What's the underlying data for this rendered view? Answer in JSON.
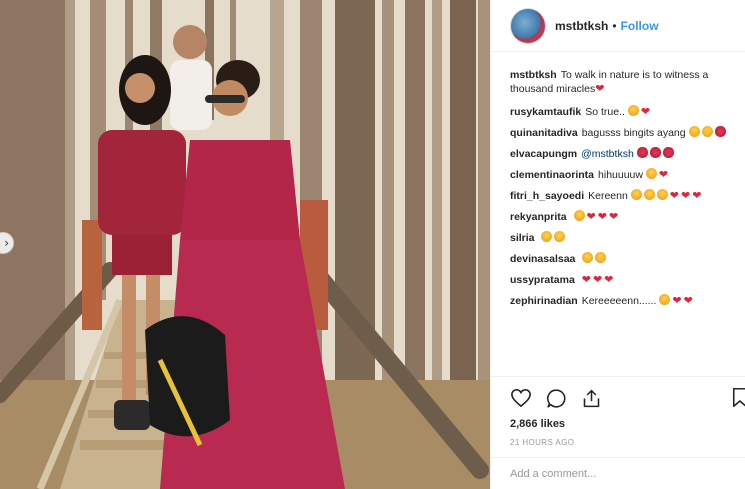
{
  "post": {
    "username": "mstbtksh",
    "follow_label": "Follow",
    "separator": "•"
  },
  "caption": {
    "username": "mstbtksh",
    "text": "To walk in nature is to witness a thousand miracles"
  },
  "comments": [
    {
      "user": "rusykamtaufik",
      "text": "So true.."
    },
    {
      "user": "quinanitadiva",
      "text": "bagusss bingits ayang"
    },
    {
      "user": "elvacapungm",
      "text": "@mstbtksh"
    },
    {
      "user": "clementinaorinta",
      "text": "hihuuuuw"
    },
    {
      "user": "fitri_h_sayoedi",
      "text": "Kereenn"
    },
    {
      "user": "rekyanprita",
      "text": ""
    },
    {
      "user": "silria",
      "text": ""
    },
    {
      "user": "devinasalsaa",
      "text": ""
    },
    {
      "user": "ussypratama",
      "text": ""
    },
    {
      "user": "zephirinadian",
      "text": "Kereeeeenn......"
    }
  ],
  "stats": {
    "likes": "2,866 likes",
    "time": "21 HOURS AGO"
  },
  "comment_box": {
    "placeholder": "Add a comment..."
  },
  "icons": {
    "like": "heart-outline-icon",
    "comment": "speech-bubble-icon",
    "share": "share-icon",
    "save": "bookmark-icon"
  },
  "colors": {
    "follow": "#3897f0",
    "mention": "#003569",
    "timestamp": "#999999",
    "heart_emoji": "#e0243f"
  }
}
